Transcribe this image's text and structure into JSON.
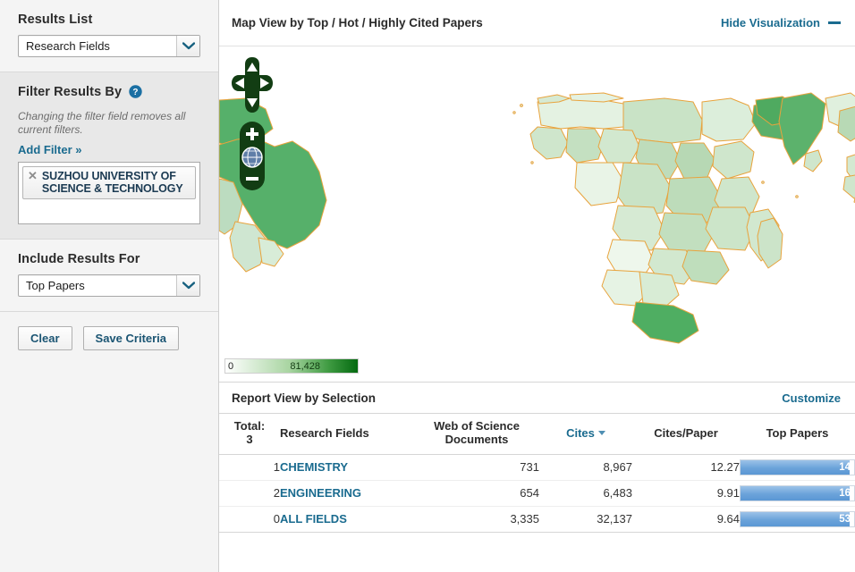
{
  "sidebar": {
    "results_list": {
      "title": "Results List",
      "selected": "Research Fields"
    },
    "filter": {
      "title": "Filter Results By",
      "help_icon": "question-mark-icon",
      "note": "Changing the filter field removes all current filters.",
      "add_filter_label": "Add Filter »",
      "chips": [
        {
          "remove_icon": "close-icon",
          "label": "SUZHOU UNIVERSITY OF SCIENCE & TECHNOLOGY"
        }
      ]
    },
    "include": {
      "title": "Include Results For",
      "selected": "Top Papers"
    },
    "buttons": {
      "clear": "Clear",
      "save": "Save Criteria"
    }
  },
  "visualization": {
    "title": "Map View by Top / Hot / Highly Cited Papers",
    "hide_label": "Hide Visualization",
    "hide_icon": "minus-icon",
    "nav": {
      "pan_icon": "pan-arrows-icon",
      "zoom_in_icon": "plus-icon",
      "globe_icon": "globe-icon",
      "zoom_out_icon": "minus-icon"
    },
    "legend": {
      "min": "0",
      "max": "81,428",
      "low_color": "#ffffff",
      "high_color": "#046a10"
    }
  },
  "report": {
    "title": "Report View by Selection",
    "customize_label": "Customize",
    "total_label": "Total:",
    "total_value": "3",
    "columns": {
      "field": "Research Fields",
      "documents": "Web of Science Documents",
      "cites": "Cites",
      "cites_per_paper": "Cites/Paper",
      "top_papers": "Top Papers"
    },
    "sort": {
      "column": "Cites",
      "direction": "desc",
      "icon": "caret-down-icon"
    },
    "rows": [
      {
        "rank": "1",
        "field": "CHEMISTRY",
        "documents": "731",
        "cites": "8,967",
        "cites_per_paper": "12.27",
        "top_papers": "14",
        "bar_pct": 96
      },
      {
        "rank": "2",
        "field": "ENGINEERING",
        "documents": "654",
        "cites": "6,483",
        "cites_per_paper": "9.91",
        "top_papers": "16",
        "bar_pct": 96
      },
      {
        "rank": "0",
        "field": "ALL FIELDS",
        "documents": "3,335",
        "cites": "32,137",
        "cites_per_paper": "9.64",
        "top_papers": "53",
        "bar_pct": 96
      }
    ]
  },
  "colors": {
    "link": "#1a6b8f",
    "bar": "#6ba3da",
    "map_border": "#e8a33d",
    "map_dark": "#1a6b2a"
  }
}
